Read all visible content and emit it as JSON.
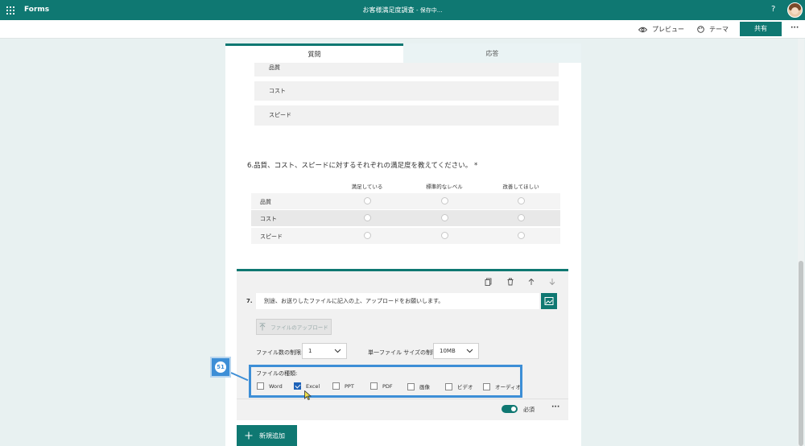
{
  "app": {
    "name": "Forms",
    "doc_title": "お客様満足度調査",
    "save_status": "- 保存中..."
  },
  "commands": {
    "preview": "プレビュー",
    "theme": "テーマ",
    "share": "共有",
    "more": "···"
  },
  "tabs": {
    "questions": "質問",
    "responses": "応答"
  },
  "q5_options": [
    "品質",
    "コスト",
    "スピード"
  ],
  "q6": {
    "title": "6.品質、コスト、スピードに対するそれぞれの満足度を教えてください。 *",
    "columns": [
      "満足している",
      "標準的なレベル",
      "改善してほしい"
    ],
    "rows": [
      "品質",
      "コスト",
      "スピード"
    ]
  },
  "q7": {
    "number": "7.",
    "text": "別途、お送りしたファイルに記入の上、アップロードをお願いします。",
    "upload_button": "ファイルのアップロード",
    "file_count_label": "ファイル数の制限:",
    "file_count_value": "1",
    "file_size_label": "単一ファイル サイズの制限:",
    "file_size_value": "10MB",
    "file_types_label": "ファイルの種類:",
    "file_types": [
      {
        "label": "Word",
        "checked": false
      },
      {
        "label": "Excel",
        "checked": true
      },
      {
        "label": "PPT",
        "checked": false
      },
      {
        "label": "PDF",
        "checked": false
      },
      {
        "label": "画像",
        "checked": false
      },
      {
        "label": "ビデオ",
        "checked": false
      },
      {
        "label": "オーディオ",
        "checked": false
      }
    ],
    "required_label": "必須",
    "more": "···"
  },
  "add_new": "新規追加",
  "callout_number": "51",
  "colors": {
    "brand": "#0f7872",
    "highlight": "#3d8ed6",
    "checkbox": "#1e62b8"
  }
}
